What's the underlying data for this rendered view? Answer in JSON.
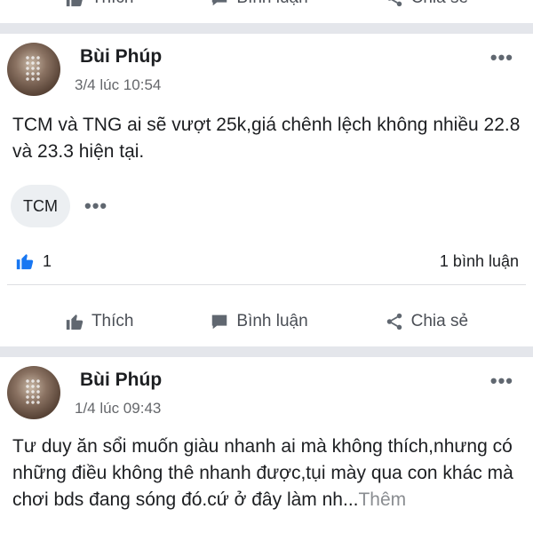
{
  "actions": {
    "like_label": "Thích",
    "comment_label": "Bình luận",
    "share_label": "Chia sẻ"
  },
  "posts": [
    {
      "author": "Bùi Phúp",
      "time": "3/4 lúc 10:54",
      "text": "TCM và TNG ai sẽ vượt 25k,giá chênh lệch không nhiều 22.8 và 23.3 hiện tại.",
      "tags": [
        "TCM"
      ],
      "like_count": "1",
      "comment_count": "1 bình luận"
    },
    {
      "author": "Bùi Phúp",
      "time": "1/4 lúc 09:43",
      "text": "Tư duy ăn sổi muốn giàu nhanh ai mà không thích,nhưng có những điều không thê nhanh được,tụi mày qua con khác mà chơi bds đang sóng đó.cứ ở đây làm nh...",
      "see_more": "Thêm"
    }
  ],
  "icons": {
    "like": "thumbs-up-icon",
    "comment": "speech-bubble-icon",
    "share": "share-icon",
    "more": "more-dots-icon"
  },
  "colors": {
    "separator": "#e4e6eb",
    "like_blue": "#1877f2",
    "secondary_text": "#65676b",
    "action_text": "#4b4f56"
  }
}
